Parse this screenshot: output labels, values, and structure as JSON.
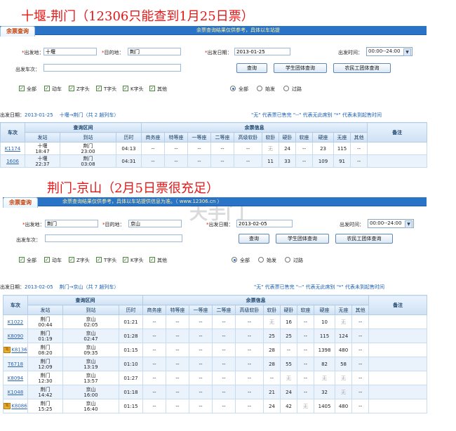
{
  "banner1": "十堰-荆门（12306只能查到1月25日票）",
  "banner2": "荆门-京山（2月5日票很充足）",
  "watermark": "天手门",
  "labels": {
    "tab": "余票查询",
    "from": "出发地：",
    "to": "目的地：",
    "date": "出发日期：",
    "time": "出发时间：",
    "train": "出发车次：",
    "btn_query": "查询",
    "btn_student": "学生团体查询",
    "btn_worker": "农民工团体查询",
    "required_mark": "*",
    "chk": [
      "全部",
      "动车",
      "Z字头",
      "T字头",
      "K字头",
      "其他"
    ],
    "radio": [
      "全部",
      "始发",
      "过路"
    ],
    "legend": "\"无\" 代表票已售完   \"--\" 代表无此席别   \"*\" 代表未到起售时间"
  },
  "headers": {
    "train": "车次",
    "section": "查询区间",
    "seats": "余票信息",
    "remark": "备注",
    "depart": "发站",
    "arrive": "到站",
    "duration": "历时",
    "seat_types": [
      "商务座",
      "特等座",
      "一等座",
      "二等座",
      "高级软卧",
      "软卧",
      "硬卧",
      "软座",
      "硬座",
      "无座",
      "其他"
    ]
  },
  "query1": {
    "notice": "余票查询结果仅供参考，具体以车站提",
    "from": "十堰",
    "to": "荆门",
    "date": "2013-01-25",
    "time": "00:00--24:00",
    "summary_label": "出发日期：",
    "summary_date": "2013-01-25",
    "summary_route": "十堰→荆门（共 2 趟列车）",
    "rows": [
      {
        "train": "K1174",
        "dep": "十堰",
        "dep_t": "18:47",
        "arr": "荆门",
        "arr_t": "23:00",
        "dur": "04:13",
        "seats": [
          "--",
          "--",
          "--",
          "--",
          "--",
          "无",
          "24",
          "--",
          "23",
          "115",
          "--"
        ]
      },
      {
        "train": "1606",
        "dep": "十堰",
        "dep_t": "22:37",
        "arr": "荆门",
        "arr_t": "03:08",
        "dur": "04:31",
        "seats": [
          "--",
          "--",
          "--",
          "--",
          "--",
          "11",
          "33",
          "--",
          "109",
          "91",
          "--"
        ]
      }
    ]
  },
  "query2": {
    "notice": "余票查询结果仅供参考，具体以车站提供信息为准。（ www.12306.cn ）",
    "from": "荆门",
    "to": "京山",
    "date": "2013-02-05",
    "time": "00:00--24:00",
    "summary_label": "出发日期：",
    "summary_date": "2013-02-05",
    "summary_route": "荆门→京山（共 7 趟列车）",
    "rows": [
      {
        "train": "K1022",
        "flag": "",
        "dep": "荆门",
        "dep_t": "00:44",
        "arr": "京山",
        "arr_t": "02:05",
        "dur": "01:21",
        "seats": [
          "--",
          "--",
          "--",
          "--",
          "--",
          "无",
          "16",
          "--",
          "10",
          "无",
          "--"
        ]
      },
      {
        "train": "K8090",
        "flag": "",
        "dep": "荆门",
        "dep_t": "01:19",
        "arr": "京山",
        "arr_t": "02:47",
        "dur": "01:28",
        "seats": [
          "--",
          "--",
          "--",
          "--",
          "--",
          "25",
          "25",
          "--",
          "115",
          "124",
          "--"
        ]
      },
      {
        "train": "K8136",
        "flag": "始",
        "dep": "荆门",
        "dep_t": "08:20",
        "arr": "京山",
        "arr_t": "09:35",
        "dur": "01:15",
        "seats": [
          "--",
          "--",
          "--",
          "--",
          "--",
          "28",
          "--",
          "--",
          "1398",
          "480",
          "--"
        ]
      },
      {
        "train": "T6718",
        "flag": "",
        "dep": "荆门",
        "dep_t": "12:09",
        "arr": "京山",
        "arr_t": "13:19",
        "dur": "01:10",
        "seats": [
          "--",
          "--",
          "--",
          "--",
          "--",
          "28",
          "55",
          "--",
          "82",
          "58",
          "--"
        ]
      },
      {
        "train": "K8094",
        "flag": "",
        "dep": "荆门",
        "dep_t": "12:30",
        "arr": "京山",
        "arr_t": "13:57",
        "dur": "01:27",
        "seats": [
          "--",
          "--",
          "--",
          "--",
          "--",
          "--",
          "无",
          "--",
          "无",
          "无",
          "--"
        ]
      },
      {
        "train": "K1048",
        "flag": "",
        "dep": "荆门",
        "dep_t": "14:42",
        "arr": "京山",
        "arr_t": "16:00",
        "dur": "01:18",
        "seats": [
          "--",
          "--",
          "--",
          "--",
          "--",
          "21",
          "24",
          "--",
          "32",
          "无",
          "--"
        ]
      },
      {
        "train": "K8086",
        "flag": "始",
        "dep": "荆门",
        "dep_t": "15:25",
        "arr": "京山",
        "arr_t": "16:40",
        "dur": "01:15",
        "seats": [
          "--",
          "--",
          "--",
          "--",
          "--",
          "24",
          "42",
          "无",
          "1405",
          "480",
          "--"
        ]
      }
    ]
  }
}
